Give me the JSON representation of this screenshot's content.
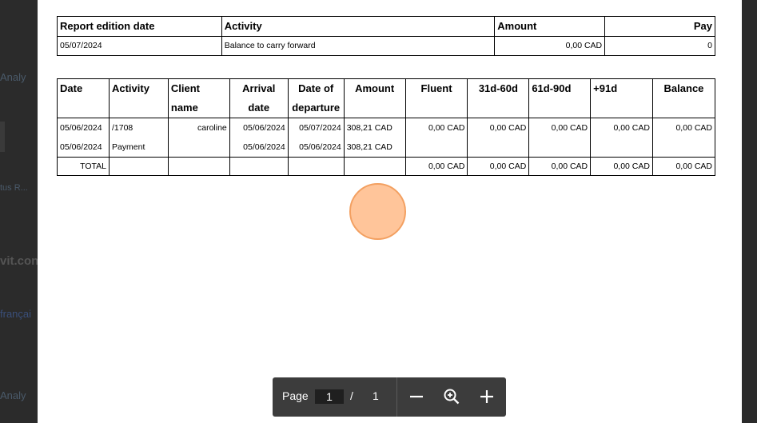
{
  "background": {
    "items": [
      {
        "text": "Analy",
        "kind": "text"
      },
      {
        "text": "tus R...",
        "kind": "text"
      },
      {
        "text": "vit.con",
        "kind": "bold"
      },
      {
        "text": "françai",
        "kind": "link"
      },
      {
        "text": "Analy",
        "kind": "text"
      }
    ]
  },
  "report": {
    "summary_headers": [
      "Report edition date",
      "Activity",
      "Amount",
      "Pay"
    ],
    "summary_row": [
      "05/07/2024",
      "Balance to carry forward",
      "0,00 CAD",
      "0"
    ],
    "detail_headers": [
      "Date",
      "Activity",
      "Client name",
      "Arrival date",
      "Date of departure",
      "Amount",
      "Fluent",
      "31d-60d",
      "61d-90d",
      "+91d",
      "Balance"
    ],
    "detail_rows": [
      [
        "05/06/2024",
        "/1708",
        "caroline",
        "05/06/2024",
        "05/07/2024",
        "308,21 CAD",
        "0,00 CAD",
        "0,00 CAD",
        "0,00 CAD",
        "0,00 CAD",
        "0,00 CAD"
      ],
      [
        "05/06/2024",
        "Payment",
        "",
        "05/06/2024",
        "05/06/2024",
        "308,21 CAD",
        "",
        "",
        "",
        "",
        ""
      ]
    ],
    "total_row": [
      "TOTAL",
      "",
      "",
      "",
      "",
      "",
      "0,00 CAD",
      "0,00 CAD",
      "0,00 CAD",
      "0,00 CAD",
      "0,00 CAD"
    ]
  },
  "toolbar": {
    "page_label": "Page",
    "current_page": "1",
    "separator": "/",
    "total_pages": "1",
    "zoom_out_icon": "minus-icon",
    "zoom_reset_icon": "magnifier-icon",
    "zoom_in_icon": "plus-icon"
  },
  "colors": {
    "backdrop": "#2b2b2b",
    "toolbar": "#3c3c3c",
    "cursor_fill": "#ffc59a",
    "cursor_border": "#f3a061"
  }
}
